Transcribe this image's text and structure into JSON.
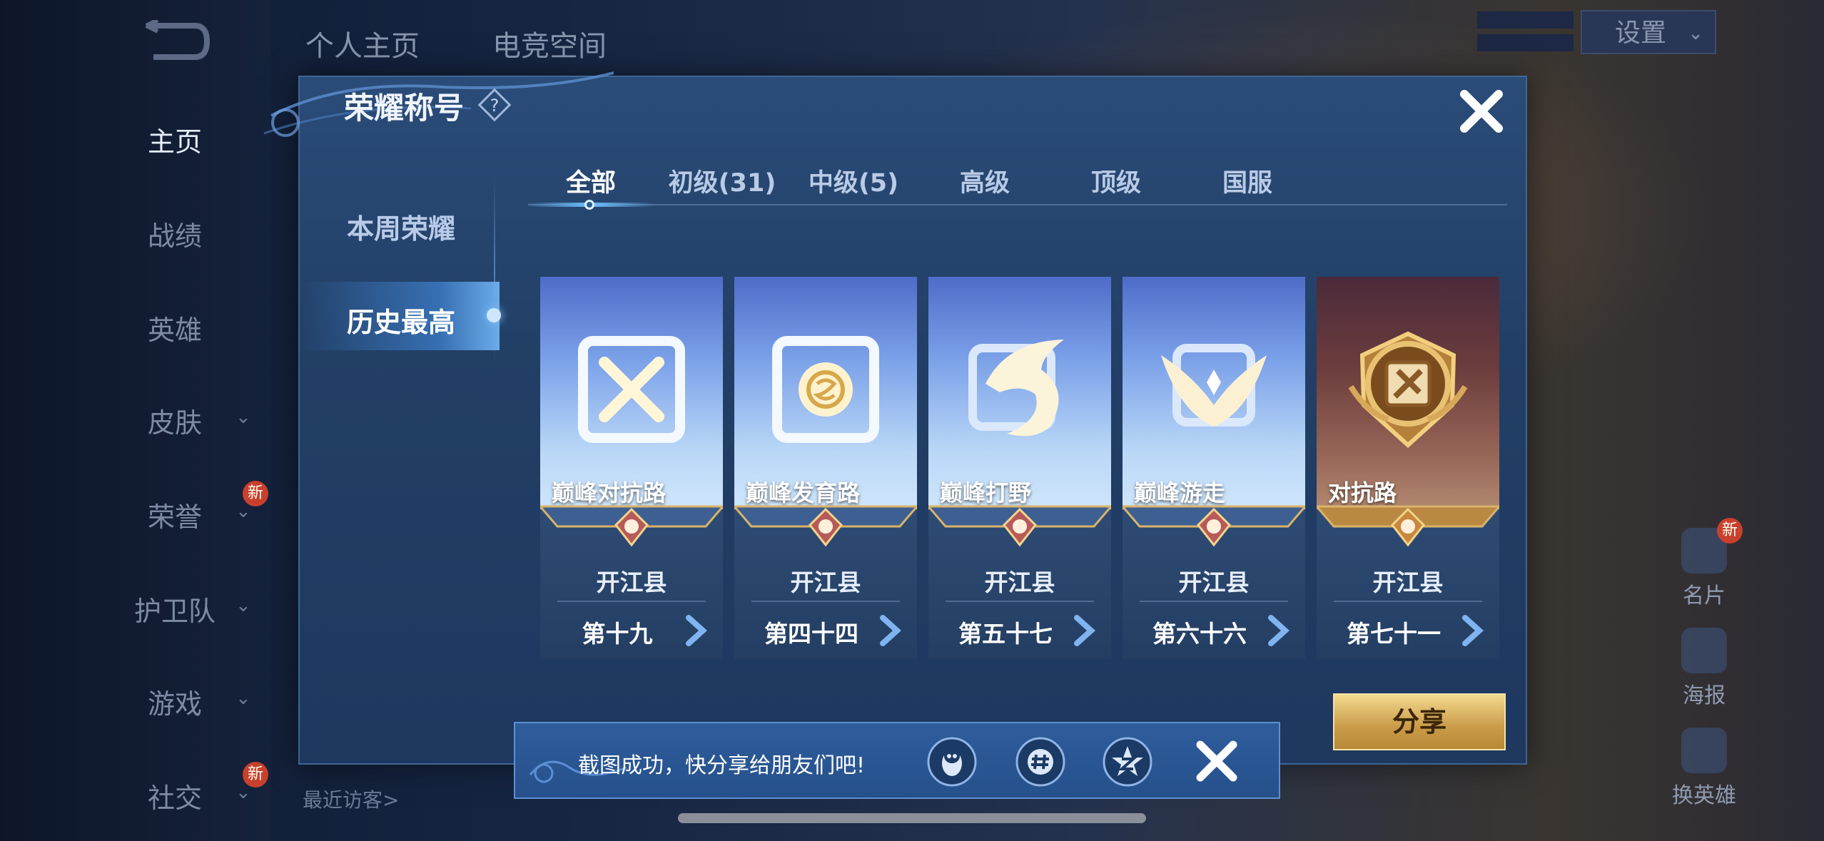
{
  "background": {
    "top_tabs": [
      "个人主页",
      "电竞空间"
    ],
    "settings_label": "设置",
    "left_nav": [
      {
        "label": "主页",
        "active": true,
        "has_chevron": false,
        "badge": ""
      },
      {
        "label": "战绩",
        "active": false,
        "has_chevron": false,
        "badge": ""
      },
      {
        "label": "英雄",
        "active": false,
        "has_chevron": false,
        "badge": ""
      },
      {
        "label": "皮肤",
        "active": false,
        "has_chevron": true,
        "badge": ""
      },
      {
        "label": "荣誉",
        "active": false,
        "has_chevron": true,
        "badge": "新"
      },
      {
        "label": "护卫队",
        "active": false,
        "has_chevron": true,
        "badge": ""
      },
      {
        "label": "游戏",
        "active": false,
        "has_chevron": true,
        "badge": ""
      },
      {
        "label": "社交",
        "active": false,
        "has_chevron": true,
        "badge": "新"
      }
    ],
    "recent_visitors": "最近访客>",
    "right_side": [
      {
        "label": "名片",
        "badge": "新"
      },
      {
        "label": "海报",
        "badge": ""
      },
      {
        "label": "换英雄",
        "badge": ""
      }
    ]
  },
  "dialog": {
    "title": "荣耀称号",
    "side_items": [
      {
        "label": "本周荣耀",
        "active": false
      },
      {
        "label": "历史最高",
        "active": true
      }
    ],
    "tabs": [
      {
        "label": "全部",
        "active": true
      },
      {
        "label": "初级(31)",
        "active": false
      },
      {
        "label": "中级(5)",
        "active": false
      },
      {
        "label": "高级",
        "active": false
      },
      {
        "label": "顶级",
        "active": false
      },
      {
        "label": "国服",
        "active": false
      }
    ],
    "cards": [
      {
        "name": "巅峰对抗路",
        "region": "开江县",
        "rank": "第十九",
        "emblem": "sword-cross-icon",
        "style": "blue"
      },
      {
        "name": "巅峰发育路",
        "region": "开江县",
        "rank": "第四十四",
        "emblem": "archer-target-icon",
        "style": "blue"
      },
      {
        "name": "巅峰打野",
        "region": "开江县",
        "rank": "第五十七",
        "emblem": "dragon-icon",
        "style": "blue"
      },
      {
        "name": "巅峰游走",
        "region": "开江县",
        "rank": "第六十六",
        "emblem": "wings-icon",
        "style": "blue"
      },
      {
        "name": "对抗路",
        "region": "开江县",
        "rank": "第七十一",
        "emblem": "gold-shield-icon",
        "style": "red"
      }
    ],
    "share_label": "分享"
  },
  "toast": {
    "message": "截图成功，快分享给朋友们吧!",
    "share_targets": [
      "qq-icon",
      "wechat-moments-icon",
      "qzone-icon"
    ]
  },
  "colors": {
    "dialog_bg": "#223f66",
    "share_gold": "#c99b48",
    "toast_bg": "#2f5d9c"
  }
}
